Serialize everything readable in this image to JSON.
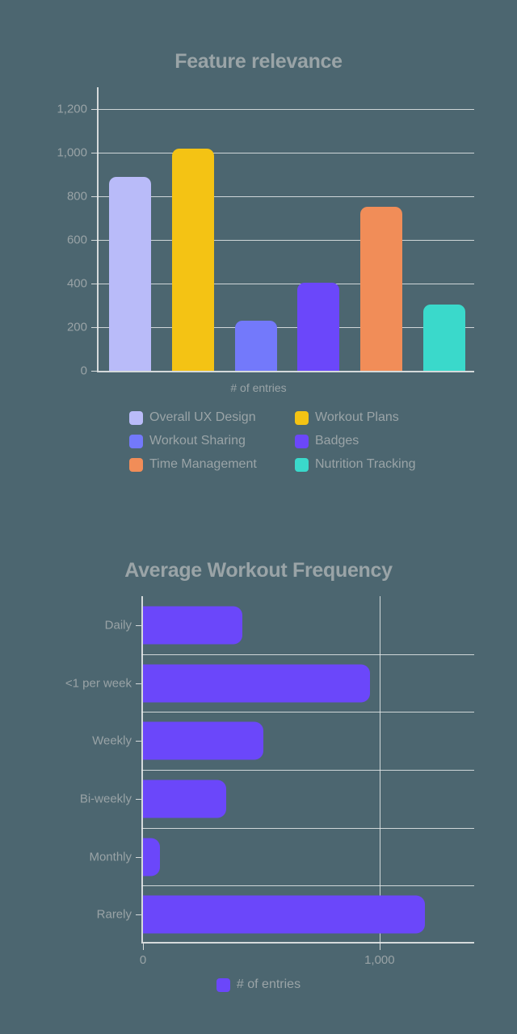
{
  "colors": {
    "background": "#4c6670",
    "text_gray": "#99a3a6",
    "axis": "#d5dadb",
    "grid": "#e6eaea"
  },
  "chart_data": [
    {
      "type": "bar",
      "orientation": "vertical",
      "title": "Feature relevance",
      "xlabel": "# of entries",
      "ylabel": "",
      "ylim": [
        0,
        1300
      ],
      "grid": true,
      "legend_position": "bottom",
      "ytick_labels": [
        "0",
        "200",
        "400",
        "600",
        "800",
        "1,000",
        "1,200"
      ],
      "ytick_values": [
        0,
        200,
        400,
        600,
        800,
        1000,
        1200
      ],
      "categories": [
        "Overall UX Design",
        "Workout Plans",
        "Workout Sharing",
        "Badges",
        "Time Management",
        "Nutrition Tracking"
      ],
      "values": [
        890,
        1020,
        230,
        405,
        752,
        305
      ],
      "colors": [
        "#b9bbf9",
        "#f4c314",
        "#7379fb",
        "#6b47fa",
        "#f18d58",
        "#3ad9cb"
      ],
      "legend": [
        {
          "label": "Overall UX Design",
          "color": "#b9bbf9"
        },
        {
          "label": "Workout Plans",
          "color": "#f4c314"
        },
        {
          "label": "Workout Sharing",
          "color": "#7379fb"
        },
        {
          "label": "Badges",
          "color": "#6b47fa"
        },
        {
          "label": "Time Management",
          "color": "#f18d58"
        },
        {
          "label": "Nutrition Tracking",
          "color": "#3ad9cb"
        }
      ]
    },
    {
      "type": "bar",
      "orientation": "horizontal",
      "title": "Average Workout Frequency",
      "xlabel": "",
      "ylabel": "",
      "xlim": [
        0,
        1400
      ],
      "grid": true,
      "legend_position": "bottom",
      "xtick_labels": [
        "0",
        "1,000"
      ],
      "xtick_values": [
        0,
        1000
      ],
      "categories": [
        "Daily",
        "<1 per week",
        "Weekly",
        "Bi-weekly",
        "Monthly",
        "Rarely"
      ],
      "values": [
        420,
        960,
        510,
        350,
        70,
        1190
      ],
      "series_name": "# of entries",
      "bar_color": "#6b47fa",
      "legend": [
        {
          "label": "# of entries",
          "color": "#6b47fa"
        }
      ]
    }
  ]
}
